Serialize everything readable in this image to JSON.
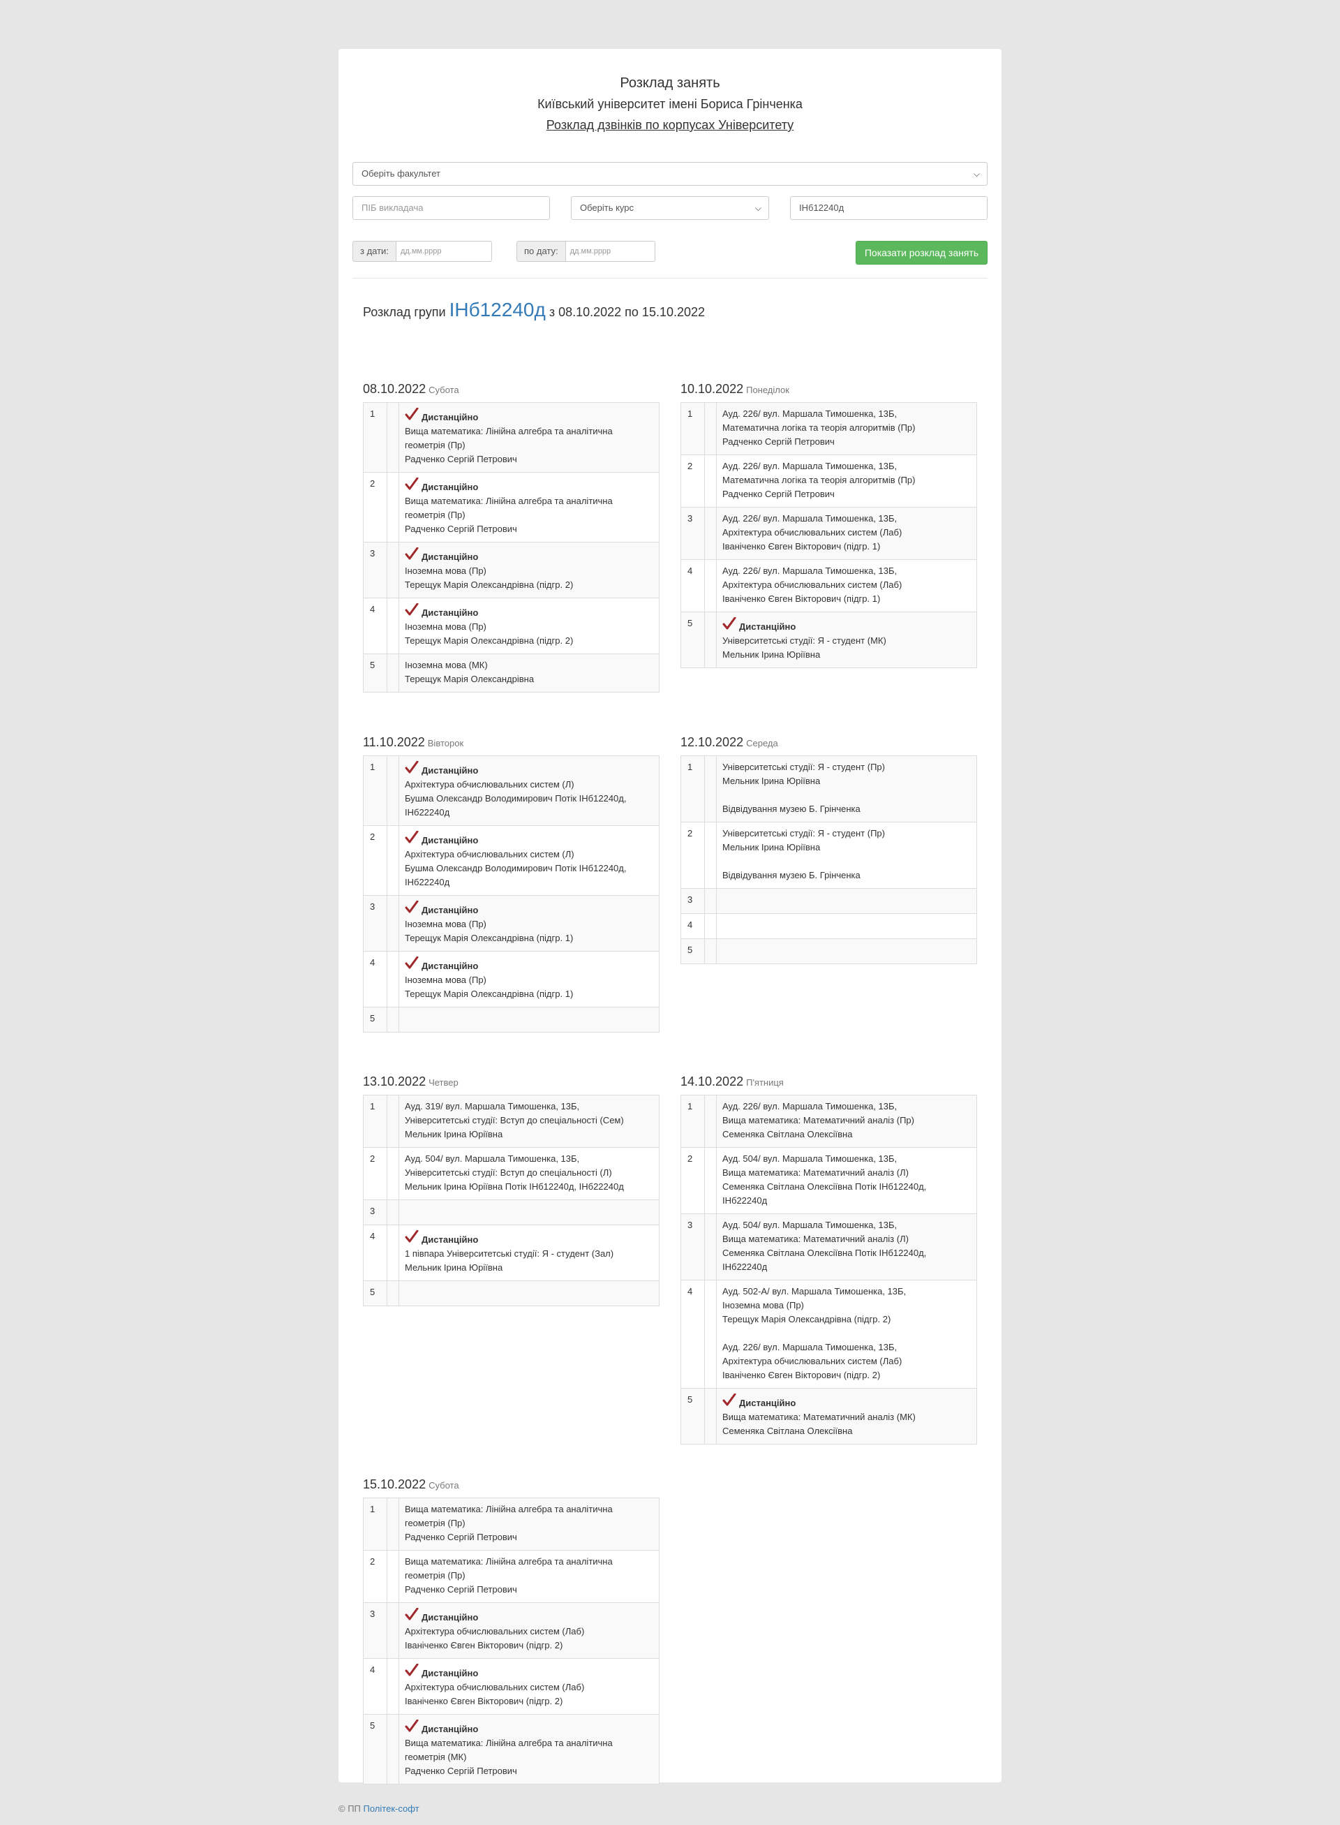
{
  "header": {
    "title": "Розклад занять",
    "university": "Київський університет імені Бориса Грінченка",
    "bells_link": "Розклад дзвінків по корпусах Університету"
  },
  "filters": {
    "faculty_placeholder": "Оберіть факультет",
    "teacher_placeholder": "ПІБ викладача",
    "course_placeholder": "Оберіть курс",
    "group_value": "ІНб12240д",
    "date_from_label": "з дати:",
    "date_to_label": "по дату:",
    "date_placeholder": "дд.мм.рррр",
    "show_button": "Показати розклад занять"
  },
  "schedule": {
    "prefix": "Розклад групи",
    "group": "ІНб12240д",
    "period": "з 08.10.2022 по 15.10.2022"
  },
  "remote_label": "Дистанційно",
  "days": [
    {
      "date": "08.10.2022",
      "weekday": "Субота",
      "lessons": [
        {
          "num": "1",
          "remote": true,
          "lines": [
            "Вища математика: Лінійна алгебра та аналітична",
            "геометрія (Пр)",
            "Радченко Сергій Петрович"
          ]
        },
        {
          "num": "2",
          "remote": true,
          "lines": [
            "Вища математика: Лінійна алгебра та аналітична",
            "геометрія (Пр)",
            "Радченко Сергій Петрович"
          ]
        },
        {
          "num": "3",
          "remote": true,
          "lines": [
            "Іноземна мова (Пр)",
            "Терещук Марія Олександрівна (підгр. 2)"
          ]
        },
        {
          "num": "4",
          "remote": true,
          "lines": [
            "Іноземна мова (Пр)",
            "Терещук Марія Олександрівна (підгр. 2)"
          ]
        },
        {
          "num": "5",
          "remote": false,
          "lines": [
            "Іноземна мова (МК)",
            "Терещук Марія Олександрівна"
          ]
        }
      ]
    },
    {
      "date": "10.10.2022",
      "weekday": "Понеділок",
      "lessons": [
        {
          "num": "1",
          "remote": false,
          "lines": [
            "Ауд. 226/ вул. Маршала Тимошенка, 13Б,",
            "Математична логіка та теорія алгоритмів (Пр)",
            "Радченко Сергій Петрович"
          ]
        },
        {
          "num": "2",
          "remote": false,
          "lines": [
            "Ауд. 226/ вул. Маршала Тимошенка, 13Б,",
            "Математична логіка та теорія алгоритмів (Пр)",
            "Радченко Сергій Петрович"
          ]
        },
        {
          "num": "3",
          "remote": false,
          "lines": [
            "Ауд. 226/ вул. Маршала Тимошенка, 13Б,",
            "Архітектура обчислювальних систем (Лаб)",
            "Іваніченко Євген Вікторович (підгр. 1)"
          ]
        },
        {
          "num": "4",
          "remote": false,
          "lines": [
            "Ауд. 226/ вул. Маршала Тимошенка, 13Б,",
            "Архітектура обчислювальних систем (Лаб)",
            "Іваніченко Євген Вікторович (підгр. 1)"
          ]
        },
        {
          "num": "5",
          "remote": true,
          "lines": [
            "Університетські студії: Я - студент (МК)",
            "Мельник Ірина Юріївна"
          ]
        }
      ]
    },
    {
      "date": "11.10.2022",
      "weekday": "Вівторок",
      "lessons": [
        {
          "num": "1",
          "remote": true,
          "lines": [
            "Архітектура обчислювальних систем (Л)",
            "Бушма Олександр Володимирович Потік ІНб12240д,",
            "ІНб22240д"
          ]
        },
        {
          "num": "2",
          "remote": true,
          "lines": [
            "Архітектура обчислювальних систем (Л)",
            "Бушма Олександр Володимирович Потік ІНб12240д,",
            "ІНб22240д"
          ]
        },
        {
          "num": "3",
          "remote": true,
          "lines": [
            "Іноземна мова (Пр)",
            "Терещук Марія Олександрівна (підгр. 1)"
          ]
        },
        {
          "num": "4",
          "remote": true,
          "lines": [
            "Іноземна мова (Пр)",
            "Терещук Марія Олександрівна (підгр. 1)"
          ]
        },
        {
          "num": "5",
          "remote": false,
          "lines": []
        }
      ]
    },
    {
      "date": "12.10.2022",
      "weekday": "Середа",
      "lessons": [
        {
          "num": "1",
          "remote": false,
          "lines": [
            "Університетські студії: Я - студент (Пр)",
            "Мельник Ірина Юріївна",
            "",
            "Відвідування музею Б. Грінченка"
          ]
        },
        {
          "num": "2",
          "remote": false,
          "lines": [
            "Університетські студії: Я - студент (Пр)",
            "Мельник Ірина Юріївна",
            "",
            "Відвідування музею Б. Грінченка"
          ]
        },
        {
          "num": "3",
          "remote": false,
          "lines": []
        },
        {
          "num": "4",
          "remote": false,
          "lines": []
        },
        {
          "num": "5",
          "remote": false,
          "lines": []
        }
      ]
    },
    {
      "date": "13.10.2022",
      "weekday": "Четвер",
      "lessons": [
        {
          "num": "1",
          "remote": false,
          "lines": [
            "Ауд. 319/ вул. Маршала Тимошенка, 13Б,",
            "Університетські студії: Вступ до спеціальності (Сем)",
            "Мельник Ірина Юріївна"
          ]
        },
        {
          "num": "2",
          "remote": false,
          "lines": [
            "Ауд. 504/ вул. Маршала Тимошенка, 13Б,",
            "Університетські студії: Вступ до спеціальності (Л)",
            "Мельник Ірина Юріївна Потік ІНб12240д, ІНб22240д"
          ]
        },
        {
          "num": "3",
          "remote": false,
          "lines": []
        },
        {
          "num": "4",
          "remote": true,
          "lines": [
            "1 півпара Університетські студії: Я - студент (Зал)",
            "Мельник Ірина Юріївна"
          ]
        },
        {
          "num": "5",
          "remote": false,
          "lines": []
        }
      ]
    },
    {
      "date": "14.10.2022",
      "weekday": "П'ятниця",
      "lessons": [
        {
          "num": "1",
          "remote": false,
          "lines": [
            "Ауд. 226/ вул. Маршала Тимошенка, 13Б,",
            "Вища математика: Математичний аналіз (Пр)",
            "Семеняка Світлана Олексіївна"
          ]
        },
        {
          "num": "2",
          "remote": false,
          "lines": [
            "Ауд. 504/ вул. Маршала Тимошенка, 13Б,",
            "Вища математика: Математичний аналіз (Л)",
            "Семеняка Світлана Олексіївна Потік ІНб12240д,",
            "ІНб22240д"
          ]
        },
        {
          "num": "3",
          "remote": false,
          "lines": [
            "Ауд. 504/ вул. Маршала Тимошенка, 13Б,",
            "Вища математика: Математичний аналіз (Л)",
            "Семеняка Світлана Олексіївна Потік ІНб12240д,",
            "ІНб22240д"
          ]
        },
        {
          "num": "4",
          "remote": false,
          "lines": [
            "Ауд. 502-А/ вул. Маршала Тимошенка, 13Б,",
            "Іноземна мова (Пр)",
            "Терещук Марія Олександрівна (підгр. 2)",
            "",
            "Ауд. 226/ вул. Маршала Тимошенка, 13Б,",
            "Архітектура обчислювальних систем (Лаб)",
            "Іваніченко Євген Вікторович (підгр. 2)"
          ]
        },
        {
          "num": "5",
          "remote": true,
          "lines": [
            "Вища математика: Математичний аналіз (МК)",
            "Семеняка Світлана Олексіївна"
          ]
        }
      ]
    },
    {
      "date": "15.10.2022",
      "weekday": "Субота",
      "lessons": [
        {
          "num": "1",
          "remote": false,
          "lines": [
            "Вища математика: Лінійна алгебра та аналітична",
            "геометрія (Пр)",
            "Радченко Сергій Петрович"
          ]
        },
        {
          "num": "2",
          "remote": false,
          "lines": [
            "Вища математика: Лінійна алгебра та аналітична",
            "геометрія (Пр)",
            "Радченко Сергій Петрович"
          ]
        },
        {
          "num": "3",
          "remote": true,
          "lines": [
            "Архітектура обчислювальних систем (Лаб)",
            "Іваніченко Євген Вікторович (підгр. 2)"
          ]
        },
        {
          "num": "4",
          "remote": true,
          "lines": [
            "Архітектура обчислювальних систем (Лаб)",
            "Іваніченко Євген Вікторович (підгр. 2)"
          ]
        },
        {
          "num": "5",
          "remote": true,
          "lines": [
            "Вища математика: Лінійна алгебра та аналітична",
            "геометрія (МК)",
            "Радченко Сергій Петрович"
          ]
        }
      ]
    }
  ],
  "footer": {
    "prefix": "© ПП",
    "link": "Політек-софт"
  },
  "colors": {
    "accent": "#337ab7",
    "button": "#5cb85c",
    "checkmark": "#a0282b"
  }
}
